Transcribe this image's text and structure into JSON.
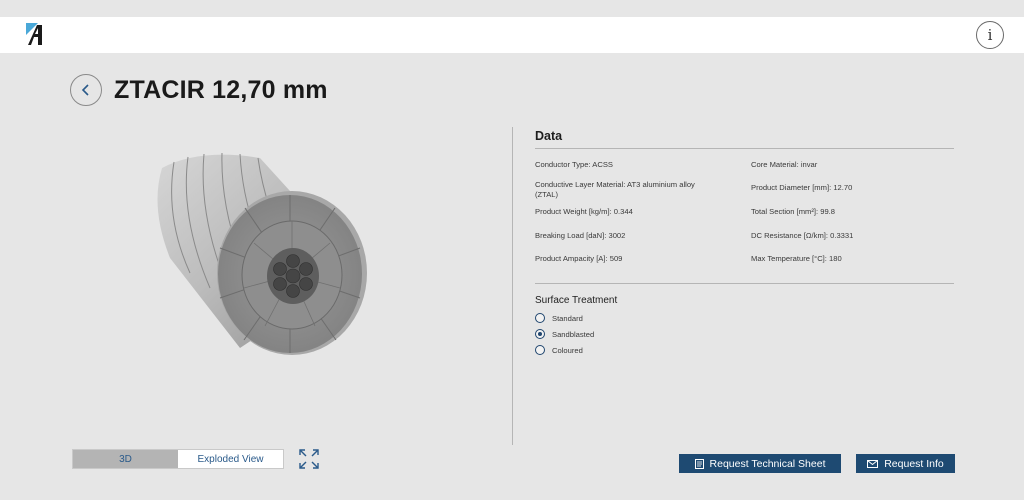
{
  "header": {
    "logo_text": "A",
    "info_icon": "info-icon"
  },
  "product": {
    "title": "ZTACIR 12,70 mm"
  },
  "data_section": {
    "title": "Data",
    "fields": {
      "conductor_type": {
        "label": "Conductor Type:",
        "value": "ACSS"
      },
      "core_material": {
        "label": "Core Material:",
        "value": "invar"
      },
      "conductive_layer": {
        "label": "Conductive Layer Material:",
        "value": "AT3 aluminium alloy",
        "value2": "(ZTAL)"
      },
      "product_diameter": {
        "label": "Product Diameter [mm]:",
        "value": "12.70"
      },
      "product_weight": {
        "label": "Product Weight [kg/m]:",
        "value": "0.344"
      },
      "total_section": {
        "label": "Total Section [mm²]:",
        "value": "99.8"
      },
      "breaking_load": {
        "label": "Breaking Load [daN]:",
        "value": "3002"
      },
      "dc_resistance": {
        "label": "DC Resistance [Ω/km]:",
        "value": "0.3331"
      },
      "product_ampacity": {
        "label": "Product Ampacity [A]:",
        "value": "509"
      },
      "max_temperature": {
        "label": "Max Temperature [°C]:",
        "value": "180"
      }
    }
  },
  "surface_treatment": {
    "title": "Surface Treatment",
    "options": [
      {
        "label": "Standard",
        "selected": false
      },
      {
        "label": "Sandblasted",
        "selected": true
      },
      {
        "label": "Coloured",
        "selected": false
      }
    ]
  },
  "view_toggle": {
    "options": [
      "3D",
      "Exploded View"
    ],
    "active": "3D"
  },
  "actions": {
    "technical_sheet": "Request Technical Sheet",
    "request_info": "Request Info"
  },
  "colors": {
    "accent": "#1e4a72",
    "background": "#e6e6e6"
  }
}
